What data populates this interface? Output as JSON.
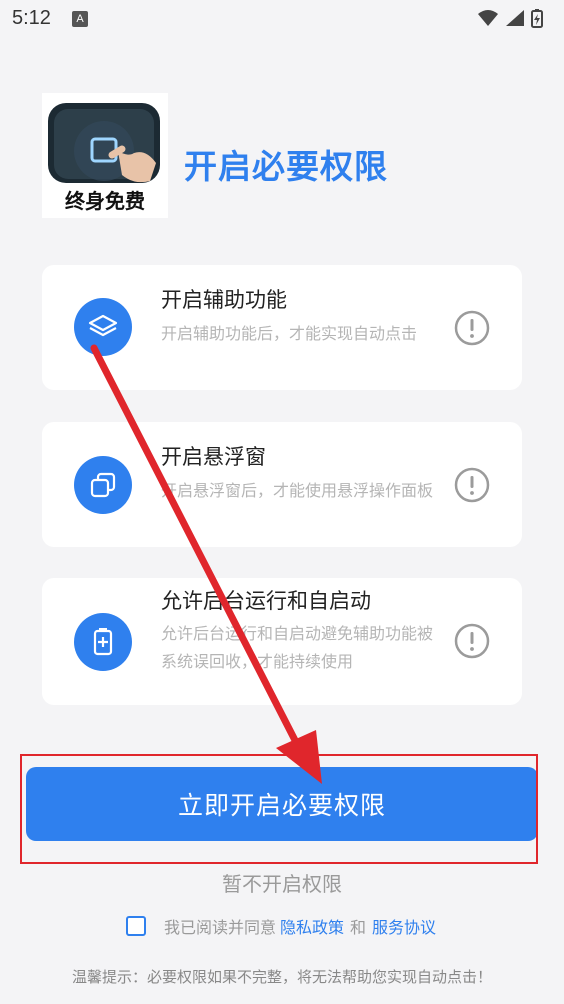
{
  "status_bar": {
    "time": "5:12",
    "notif": "A"
  },
  "header": {
    "title": "开启必要权限",
    "logo_text": "终身免费"
  },
  "permissions": [
    {
      "title": "开启辅助功能",
      "desc": "开启辅助功能后，才能实现自动点击",
      "icon": "layers-icon"
    },
    {
      "title": "开启悬浮窗",
      "desc": "开启悬浮窗后，才能使用悬浮操作面板",
      "icon": "window-icon"
    },
    {
      "title": "允许后台运行和自启动",
      "desc": "允许后台运行和自启动避免辅助功能被系统误回收，才能持续使用",
      "icon": "battery-plus-icon"
    }
  ],
  "actions": {
    "primary": "立即开启必要权限",
    "secondary": "暂不开启权限"
  },
  "agreement": {
    "text": "我已阅读并同意",
    "privacy": "隐私政策",
    "and": "和",
    "service": "服务协议"
  },
  "tip": "温馨提示：必要权限如果不完整，将无法帮助您实现自动点击！",
  "colors": {
    "accent": "#2f80ee",
    "annotation": "#e0262c"
  }
}
